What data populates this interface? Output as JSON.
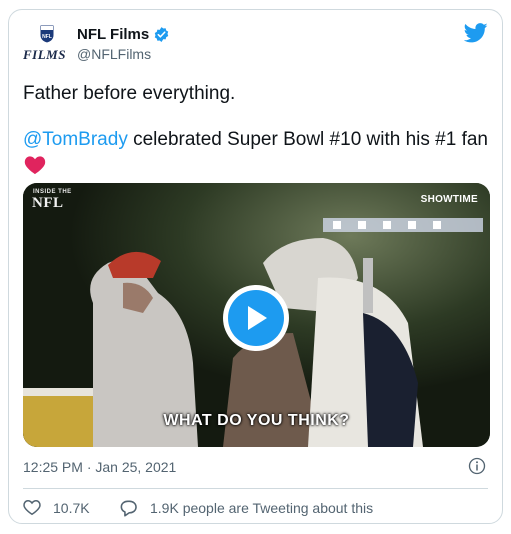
{
  "author": {
    "display_name": "NFL Films",
    "handle": "@NFLFilms",
    "avatar_text": "FILMS"
  },
  "tweet": {
    "line1": "Father before everything.",
    "mention": "@TomBrady",
    "line2_rest": " celebrated Super Bowl #10 with his #1 fan"
  },
  "video": {
    "overlay_small": "INSIDE THE",
    "overlay_logo": "NFL",
    "network": "SHOWTIME",
    "subtitle": "WHAT DO YOU THINK?"
  },
  "meta": {
    "timestamp": "12:25 PM · Jan 25, 2021"
  },
  "stats": {
    "likes": "10.7K",
    "tweeting_text": "1.9K people are Tweeting about this"
  },
  "colors": {
    "accent": "#1d9bf0",
    "heart": "#e0245e",
    "muted": "#536471"
  }
}
